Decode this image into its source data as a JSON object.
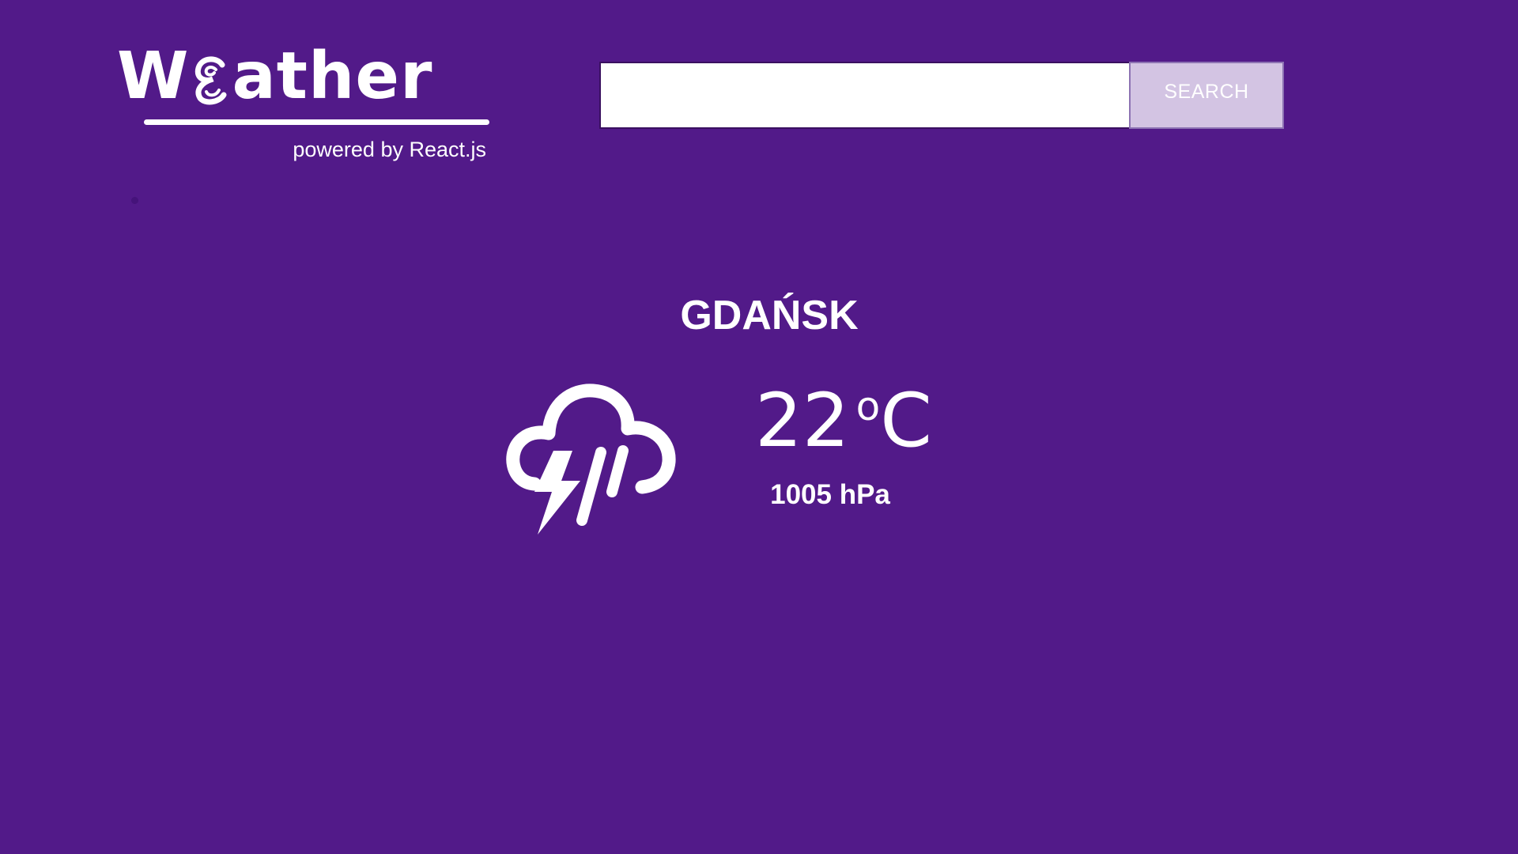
{
  "app": {
    "logo_prefix": "W",
    "logo_suffix": "ather",
    "logo_icon": "swirl-e-icon",
    "tagline": "powered by React.js"
  },
  "search": {
    "value": "",
    "placeholder": "",
    "button_label": "SEARCH"
  },
  "weather": {
    "city": "GDAŃSK",
    "icon": "thunderstorm-rain-icon",
    "temperature_value": "22",
    "temperature_degree": "o",
    "temperature_unit": "C",
    "pressure": "1005 hPa"
  },
  "colors": {
    "background": "#521a89",
    "search_button_bg": "#d3c4e3",
    "text": "#ffffff"
  }
}
